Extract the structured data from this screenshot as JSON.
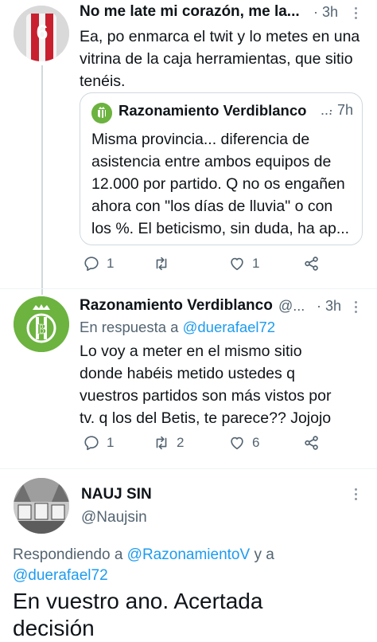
{
  "tweet1": {
    "display_name": "No me late mi corazón, me la...",
    "time": "· 3h",
    "text": "Ea, po enmarca el twit y lo metes en una vitrina de la caja herramientas, que sitio tenéis.",
    "quote": {
      "display_name": "Razonamiento Verdiblanco",
      "ellipsis": "...",
      "time": "· 7h",
      "text": "Misma provincia... diferencia de asistencia entre ambos equipos de 12.000 por partido. Q no os engañen ahora con \"los días de lluvia\" o con los %. El beticismo, sin duda, ha ap..."
    },
    "actions": {
      "replies": "1",
      "retweets": "",
      "likes": "1"
    }
  },
  "tweet2": {
    "display_name": "Razonamiento Verdiblanco",
    "handle_trunc": "@...",
    "time": "· 3h",
    "reply_prefix": "En respuesta a",
    "reply_to": "@duerafael72",
    "text": "Lo voy a meter en el mismo sitio donde habéis metido ustedes q vuestros partidos son más vistos por tv. q los del Betis, te parece?? Jojojo",
    "actions": {
      "replies": "1",
      "retweets": "2",
      "likes": "6"
    }
  },
  "tweet3": {
    "display_name": "NAUJ SIN",
    "handle": "@Naujsin",
    "reply_prefix": "Respondiendo a",
    "reply_to_1": "@RazonamientoV",
    "reply_joiner": "y a",
    "reply_to_2": "@duerafael72",
    "text": "En vuestro ano. Acertada decisión"
  },
  "colors": {
    "accent": "#1d9bf0",
    "muted": "#536471",
    "betis_green": "#6cb33f"
  }
}
